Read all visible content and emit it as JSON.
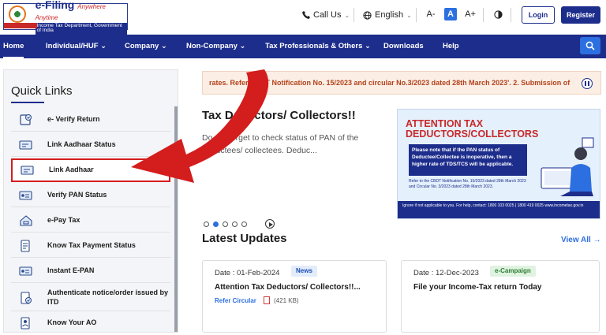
{
  "header": {
    "logo_title": "e-Filing",
    "logo_tagline": "Anywhere Anytime",
    "logo_sub": "Income Tax Department, Government of India",
    "call_us": "Call Us",
    "language": "English",
    "font_small": "A-",
    "font_normal": "A",
    "font_large": "A+",
    "login": "Login",
    "register": "Register"
  },
  "nav": {
    "items": [
      "Home",
      "Individual/HUF",
      "Company",
      "Non-Company",
      "Tax Professionals & Others",
      "Downloads",
      "Help"
    ]
  },
  "quick_links": {
    "title": "Quick Links",
    "items": [
      {
        "label": "e- Verify Return",
        "icon": "verify-return-icon"
      },
      {
        "label": "Link Aadhaar Status",
        "icon": "aadhaar-status-icon"
      },
      {
        "label": "Link Aadhaar",
        "icon": "link-aadhaar-icon"
      },
      {
        "label": "Verify PAN Status",
        "icon": "pan-status-icon"
      },
      {
        "label": "e-Pay Tax",
        "icon": "epay-tax-icon"
      },
      {
        "label": "Know Tax Payment Status",
        "icon": "tax-payment-status-icon"
      },
      {
        "label": "Instant E-PAN",
        "icon": "instant-epan-icon"
      },
      {
        "label": "Authenticate notice/order issued by ITD",
        "icon": "authenticate-notice-icon"
      },
      {
        "label": "Know Your AO",
        "icon": "know-ao-icon"
      }
    ]
  },
  "ticker": {
    "text": "rates. Refer CBDT Notification No. 15/2023 and circular No.3/2023 dated 28th March 2023'. 2. Submission of"
  },
  "hero": {
    "title": "Tax Deductors/ Collectors!!",
    "desc": "Do not forget to check status of PAN of the deductees/ collectees. Deduc..."
  },
  "banner": {
    "heading_line1": "ATTENTION TAX",
    "heading_line2": "DEDUCTORS/COLLECTORS",
    "box_text": "Please note that if the PAN status of Deductee/Collectee is inoperative, then a higher rate of TDS/TCS will be applicable.",
    "ref_text": "Refer to the CBDT Notification No. 15/2023 dated 28th March 2023 and Circular No. 3/2023 dated 28th March 2023.",
    "foot_text": "Ignore if not applicable to you. For help, contact: 1800 103 0025 | 1800 419 0025 www.incometax.gov.in"
  },
  "latest_updates": {
    "title": "Latest Updates",
    "view_all": "View All →",
    "cards": [
      {
        "date": "Date : 01-Feb-2024",
        "tag": "News",
        "text": "Attention Tax Deductors/ Collectors!!...",
        "link": "Refer Circular",
        "size": "(421 KB)"
      },
      {
        "date": "Date : 12-Dec-2023",
        "tag": "e-Campaign",
        "text": "File your Income-Tax return Today"
      }
    ]
  },
  "colors": {
    "brand_navy": "#1d2d8c",
    "accent_blue": "#2c6fe0",
    "highlight_red": "#d41d1d"
  }
}
